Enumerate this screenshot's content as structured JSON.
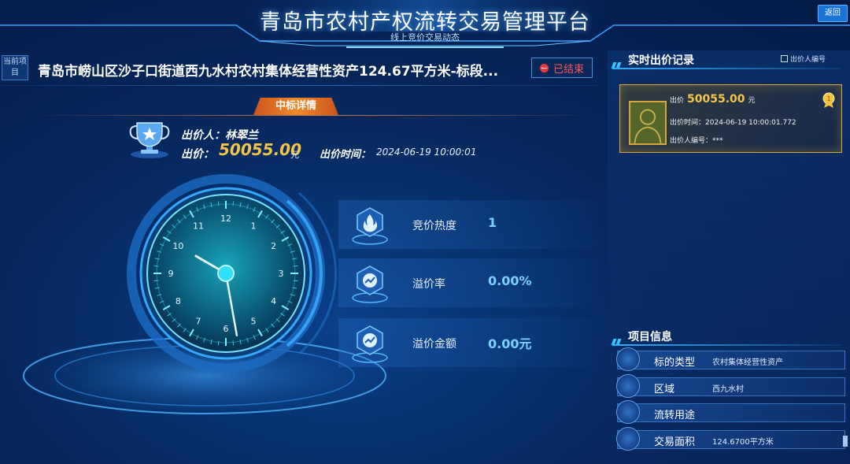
{
  "header": {
    "title": "青岛市农村产权流转交易管理平台",
    "subtitle": "线上竞价交易动态",
    "back_label": "返回"
  },
  "project": {
    "current_tag": "当前项目",
    "title": "青岛市崂山区沙子口街道西九水村农村集体经营性资产124.67平方米-标段...",
    "status": "已结束"
  },
  "winning": {
    "banner": "中标详情",
    "bidder_label": "出价人：林翠兰",
    "price_label": "出价：",
    "price_value": "50055.00",
    "price_unit": "元",
    "time_label": "出价时间：",
    "time_value": "2024-06-19 10:00:01"
  },
  "clock": {
    "numbers": [
      "12",
      "1",
      "2",
      "3",
      "4",
      "5",
      "6",
      "7",
      "8",
      "9",
      "10",
      "11"
    ],
    "hour_hand_deg": 300,
    "minute_hand_deg": 170
  },
  "stats": [
    {
      "label": "竞价热度",
      "value": "1",
      "icon": "flame-icon"
    },
    {
      "label": "溢价率",
      "value": "0.00%",
      "icon": "trend-icon"
    },
    {
      "label": "溢价金额",
      "value": "0.00元",
      "icon": "trend-icon"
    }
  ],
  "bid_records": {
    "title": "实时出价记录",
    "bidder_no_toggle": "出价人编号",
    "latest": {
      "price_label": "出价",
      "price_value": "50055.00",
      "price_unit": "元",
      "time_label": "出价时间：",
      "time_value": "2024-06-19 10:00:01.772",
      "bidder_no_label": "出价人编号：",
      "bidder_no_value": "***"
    }
  },
  "project_info": {
    "title": "项目信息",
    "items": [
      {
        "label": "标的类型",
        "value": "农村集体经营性资产",
        "icon": "cube-icon"
      },
      {
        "label": "区域",
        "value": "西九水村",
        "icon": "map-pin-icon"
      },
      {
        "label": "流转用途",
        "value": "",
        "icon": "document-icon"
      },
      {
        "label": "交易面积",
        "value": "124.6700平方米",
        "icon": "database-icon"
      }
    ]
  },
  "colors": {
    "accent": "#36c6ff",
    "gold": "#f6c546",
    "status_red": "#ff5a5a",
    "banner_orange": "#f08a2a"
  }
}
